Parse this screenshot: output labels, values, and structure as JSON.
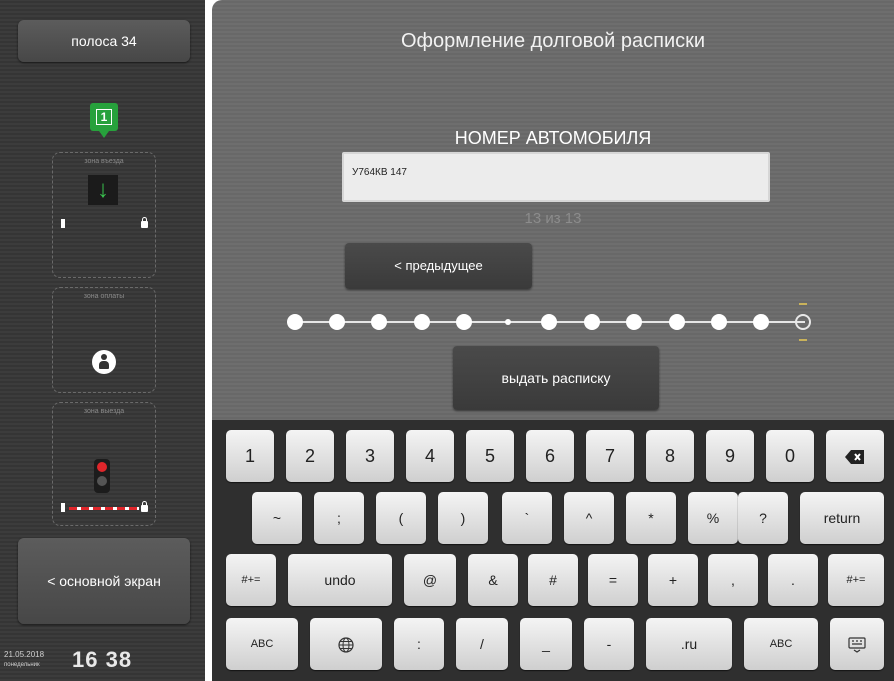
{
  "sidebar": {
    "lane_label": "полоса 34",
    "badge_number": "1",
    "exit_zone_label": "зона въезда",
    "payment_zone_label": "зона оплаты",
    "exit_zone2_label": "зона выезда",
    "main_screen_label": "< основной экран",
    "date": "21.05.2018",
    "weekday": "понедельник",
    "time": "16 38"
  },
  "main": {
    "title": "Оформление долговой расписки",
    "field_label": "НОМЕР АВТОМОБИЛЯ",
    "plate_value": "У764КВ 147",
    "counter": "13 из 13",
    "prev_button": "< предыдущее",
    "issue_button": "выдать расписку",
    "progress": {
      "total": 13,
      "current": 13
    }
  },
  "keyboard": {
    "row1": [
      "1",
      "2",
      "3",
      "4",
      "5",
      "6",
      "7",
      "8",
      "9",
      "0"
    ],
    "row2": [
      "~",
      ";",
      "(",
      ")",
      "`",
      "^",
      "*",
      "%",
      "?",
      "return"
    ],
    "row3": [
      "#+=",
      "undo",
      "@",
      "&",
      "#",
      "=",
      "+",
      ",",
      ".",
      "#+="
    ],
    "row4": [
      "ABC",
      "",
      ":",
      "/",
      "_",
      "-",
      ".ru",
      "ABC",
      ""
    ]
  }
}
